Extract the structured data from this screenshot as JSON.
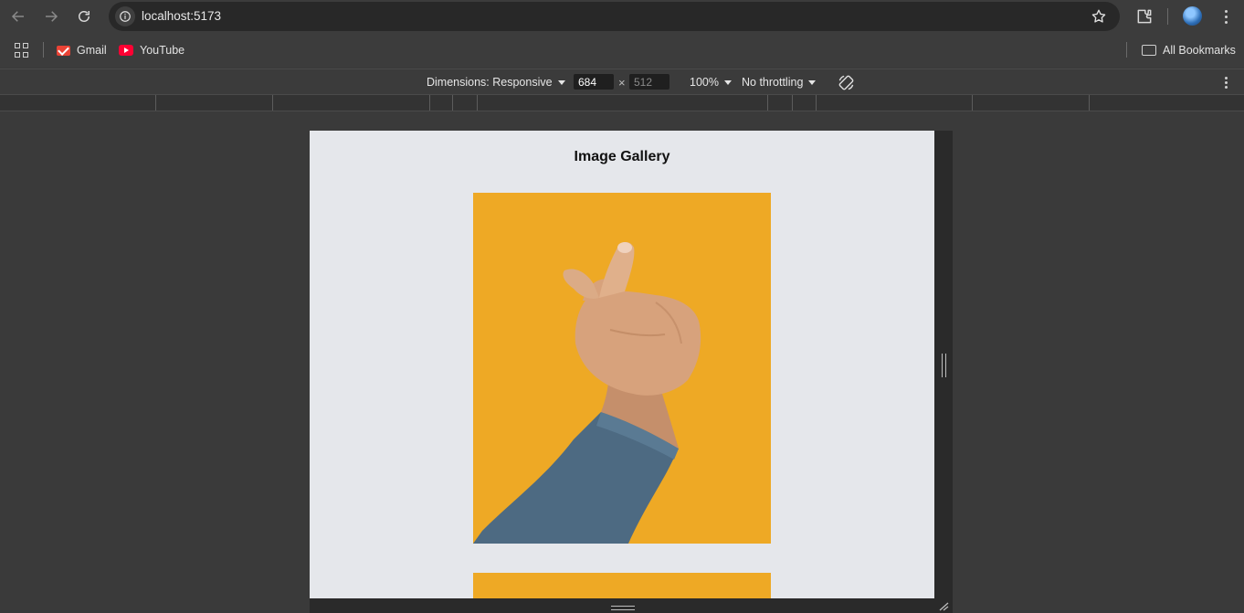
{
  "browser": {
    "url": "localhost:5173",
    "bookmarks": [
      {
        "label": "Gmail",
        "icon": "gmail-icon"
      },
      {
        "label": "YouTube",
        "icon": "youtube-icon"
      }
    ],
    "all_bookmarks_label": "All Bookmarks"
  },
  "devtools": {
    "dimensions_label": "Dimensions: Responsive",
    "width_value": "684",
    "height_value": "512",
    "times": "×",
    "zoom_label": "100%",
    "throttling_label": "No throttling"
  },
  "page": {
    "title": "Image Gallery",
    "images": [
      {
        "alt": "hand-snap-gesture"
      },
      {
        "alt": "second-image"
      }
    ]
  },
  "colors": {
    "image_bg": "#eea925",
    "viewport_bg": "#e5e7eb"
  }
}
